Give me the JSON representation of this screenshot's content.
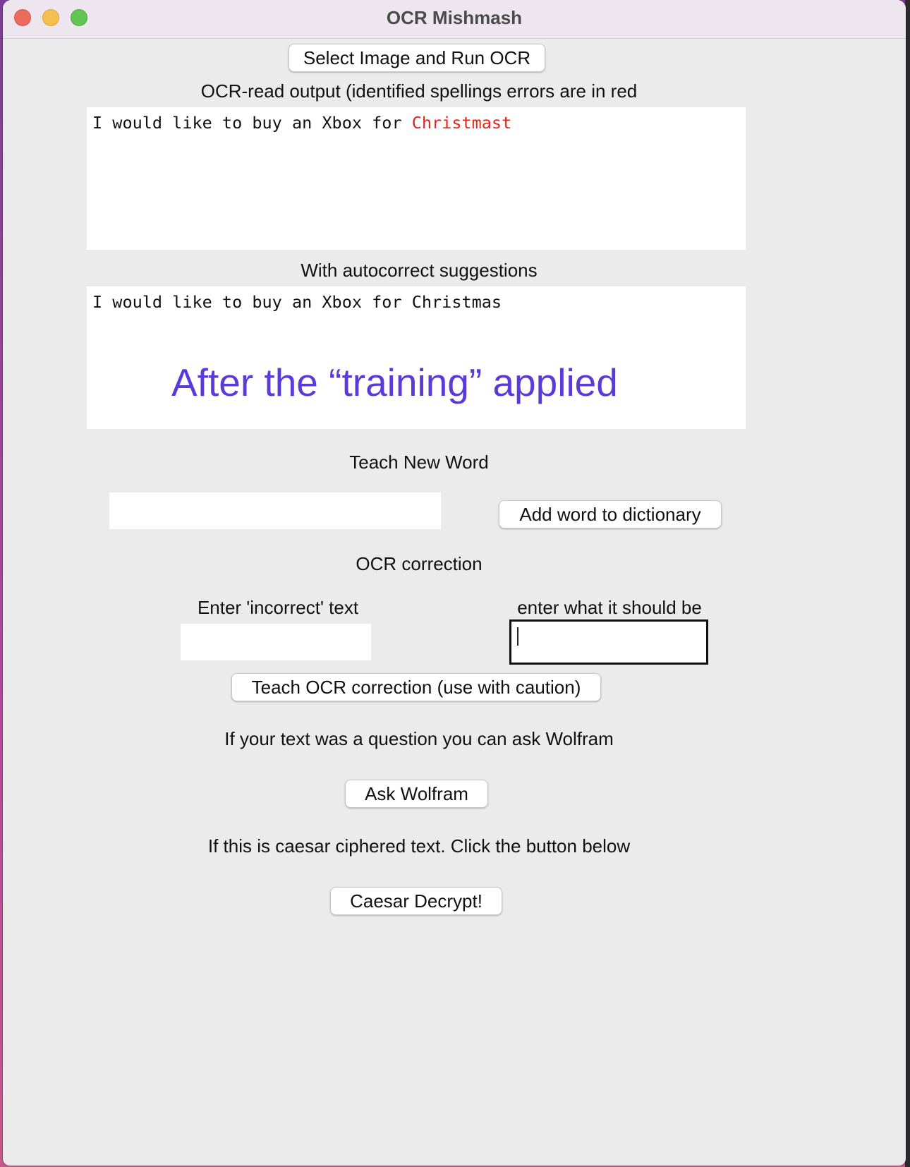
{
  "window": {
    "title": "OCR Mishmash"
  },
  "buttons": {
    "select_image": "Select Image and Run OCR",
    "add_word": "Add word to dictionary",
    "teach_correction": "Teach OCR correction (use with caution)",
    "ask_wolfram": "Ask Wolfram",
    "caesar_decrypt": "Caesar Decrypt!"
  },
  "ocr_output": {
    "label": "OCR-read output (identified spellings errors are in red",
    "text_correct": "I would like to buy an Xbox for ",
    "text_error": "Christmast"
  },
  "autocorrect": {
    "label": "With autocorrect suggestions",
    "text": "I would like to buy an Xbox for Christmas",
    "annotation": "After the “training” applied"
  },
  "teach_word": {
    "label": "Teach New Word",
    "input_value": ""
  },
  "ocr_correction": {
    "label": "OCR correction",
    "incorrect_label": "Enter 'incorrect' text",
    "incorrect_value": "",
    "correct_label": "enter what it should be",
    "correct_value": ""
  },
  "wolfram": {
    "label": "If your text was a question you can ask Wolfram"
  },
  "caesar": {
    "label": "If this is caesar ciphered text. Click the button below"
  }
}
